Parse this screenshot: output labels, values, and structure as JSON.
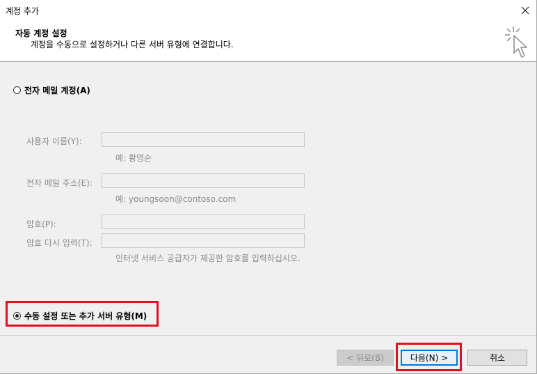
{
  "window": {
    "title": "계정 추가"
  },
  "header": {
    "title": "자동 계정 설정",
    "subtitle": "계정을 수동으로 설정하거나 다른 서버 유형에 연결합니다."
  },
  "options": {
    "email_account": {
      "label": "전자 메일 계정(A)",
      "selected": false
    },
    "manual_setup": {
      "label": "수동 설정 또는 추가 서버 유형(M)",
      "selected": true
    }
  },
  "form": {
    "name_label": "사용자 이름(Y):",
    "name_value": "",
    "name_hint": "예: 황영순",
    "email_label": "전자 메일 주소(E):",
    "email_value": "",
    "email_hint": "예: youngsoon@contoso.com",
    "password_label": "암호(P):",
    "password_value": "",
    "password_confirm_label": "암호 다시 입력(T):",
    "password_confirm_value": "",
    "password_hint": "인터넷 서비스 공급자가 제공한 암호를 입력하십시오."
  },
  "buttons": {
    "back": "< 뒤로(B)",
    "next": "다음(N) >",
    "cancel": "취소"
  },
  "colors": {
    "highlight": "#e01020",
    "primary_border": "#0078d7"
  }
}
